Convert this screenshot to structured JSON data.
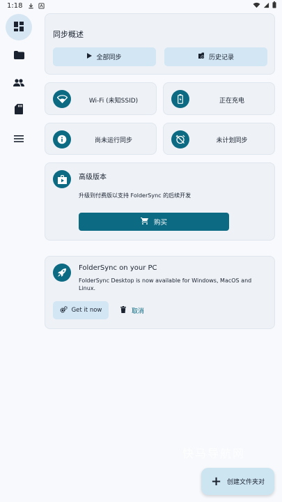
{
  "status_bar": {
    "time": "1:18"
  },
  "overview": {
    "title": "同步概述",
    "sync_all_label": "全部同步",
    "history_label": "历史记录"
  },
  "tiles": {
    "wifi": "Wi-Fi (未知SSID)",
    "charging": "正在充电",
    "not_running": "尚未运行同步",
    "unplanned": "未计划同步"
  },
  "premium": {
    "title": "高级版本",
    "description": "升级到付费版以支持 FolderSync 的后续开发",
    "buy_label": "购买"
  },
  "desktop": {
    "title": "FolderSync on your PC",
    "description": "FolderSync Desktop is now available for Windows, MacOS and Linux.",
    "get_label": "Get it now",
    "cancel_label": "取消"
  },
  "fab": {
    "label": "创建文件夹对"
  },
  "watermark": "快马导航网"
}
